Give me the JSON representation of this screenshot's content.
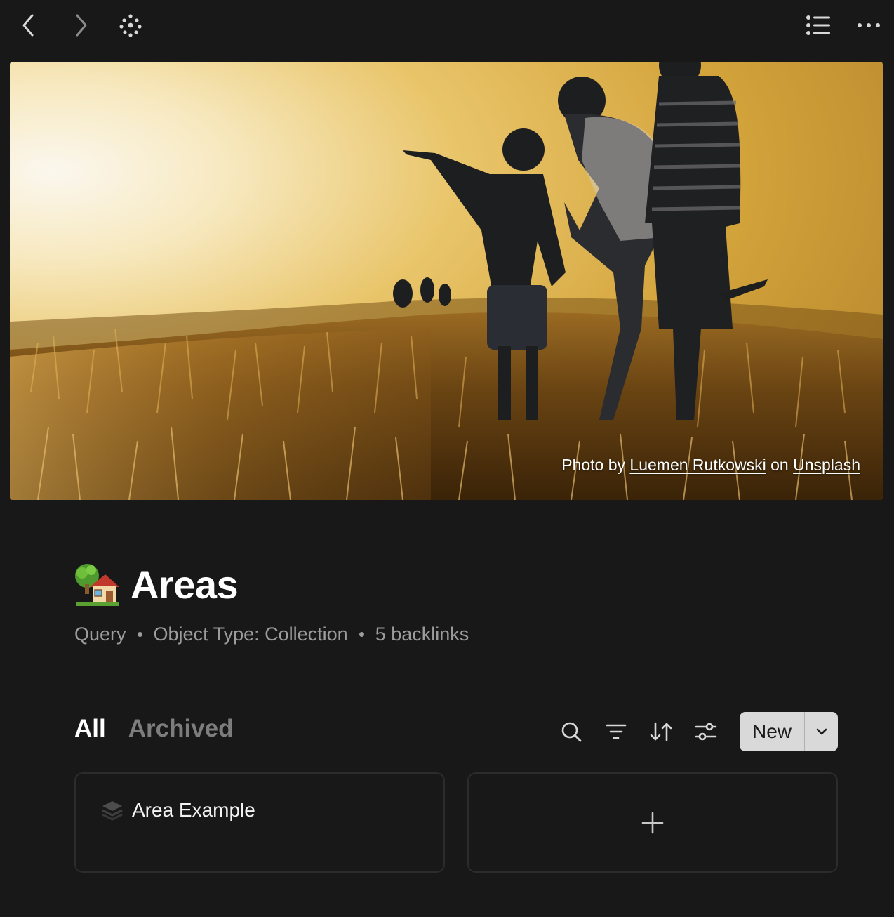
{
  "toolbar": {
    "back_icon": "chevron-left-icon",
    "forward_icon": "chevron-right-icon",
    "graph_icon": "graph-dots-icon",
    "toc_icon": "list-icon",
    "more_icon": "more-horizontal-icon"
  },
  "cover": {
    "credit_prefix": "Photo by ",
    "credit_author": "Luemen Rutkowski",
    "credit_on": " on ",
    "credit_site": "Unsplash"
  },
  "page": {
    "icon": "house-with-garden-emoji",
    "title": "Areas",
    "meta": [
      "Query",
      "Object Type: Collection",
      "5 backlinks"
    ]
  },
  "tabs": [
    "All",
    "Archived"
  ],
  "actions": {
    "search_icon": "search-icon",
    "filter_icon": "filter-icon",
    "sort_icon": "sort-icon",
    "settings_icon": "sliders-icon",
    "new_label": "New"
  },
  "cards": [
    {
      "title": "Area Example",
      "icon": "stack-icon"
    }
  ],
  "colors": {
    "background": "#181819",
    "text": "#f2f2f2",
    "muted": "#9c9c9c",
    "button_bg": "#d9d9d9"
  }
}
